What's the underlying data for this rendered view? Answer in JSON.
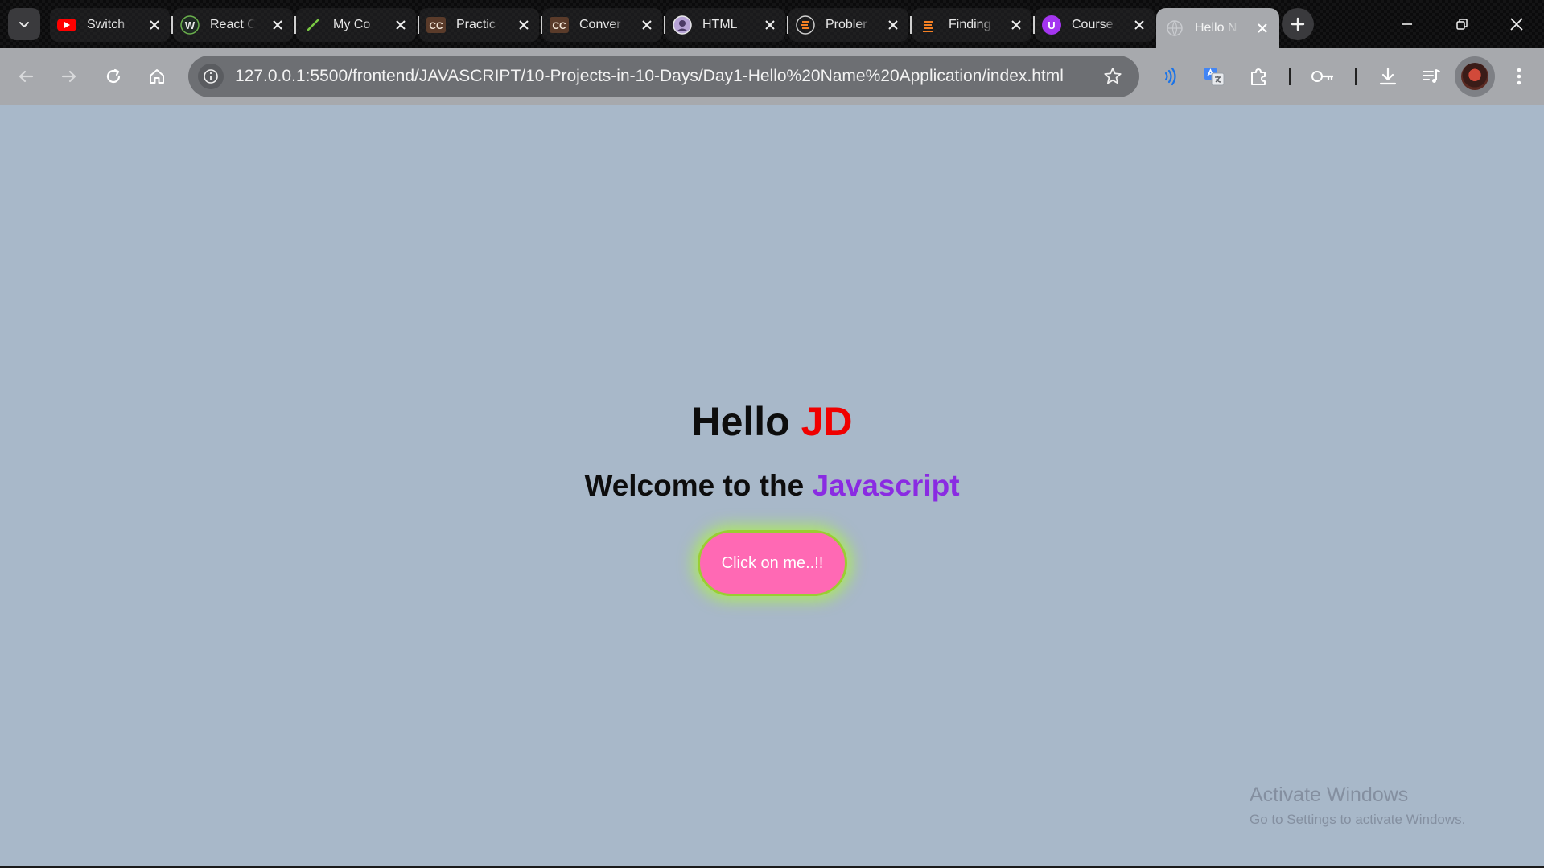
{
  "browser": {
    "tabs": [
      {
        "title": "Switch",
        "icon": "youtube-icon",
        "active": false
      },
      {
        "title": "React C",
        "icon": "w3-icon",
        "active": false
      },
      {
        "title": "My Co",
        "icon": "leaf-icon",
        "active": false
      },
      {
        "title": "Practic",
        "icon": "cc-icon",
        "active": false
      },
      {
        "title": "Conver",
        "icon": "cc-icon",
        "active": false
      },
      {
        "title": "HTML",
        "icon": "avatar-icon",
        "active": false
      },
      {
        "title": "Probler",
        "icon": "stack-icon",
        "active": false
      },
      {
        "title": "Finding",
        "icon": "stack-icon",
        "active": false
      },
      {
        "title": "Course",
        "icon": "udemy-icon",
        "active": false
      },
      {
        "title": "Hello N",
        "icon": "globe-icon",
        "active": true
      }
    ],
    "icons": {
      "cc_label": "CC",
      "udemy_label": "U",
      "w3_label": "W"
    },
    "address_bar": {
      "url": "127.0.0.1:5500/frontend/JAVASCRIPT/10-Projects-in-10-Days/Day1-Hello%20Name%20Application/index.html"
    }
  },
  "page": {
    "hello_prefix": "Hello ",
    "hello_name": "JD",
    "welcome_prefix": "Welcome to the ",
    "welcome_lang": "Javascript",
    "button_label": "Click on me..!!",
    "colors": {
      "background": "#a8b8c9",
      "name": "#f00000",
      "lang": "#8a2be2",
      "button": "#ff69b4",
      "button_glow": "#9acd32"
    }
  },
  "os": {
    "watermark_title": "Activate Windows",
    "watermark_subtitle": "Go to Settings to activate Windows."
  }
}
